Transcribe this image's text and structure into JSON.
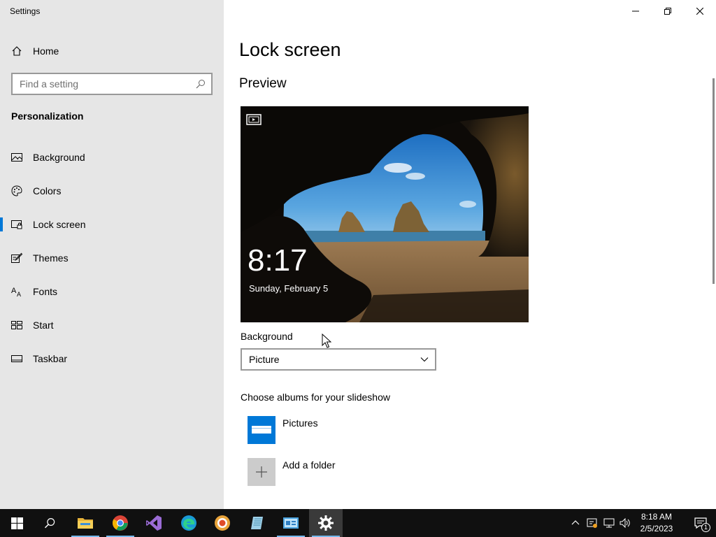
{
  "window": {
    "title": "Settings",
    "controls": [
      "minimize-icon",
      "restore-icon",
      "close-icon"
    ]
  },
  "sidebar": {
    "home_label": "Home",
    "search_placeholder": "Find a setting",
    "section_title": "Personalization",
    "items": [
      {
        "label": "Background",
        "icon": "picture-icon",
        "selected": false
      },
      {
        "label": "Colors",
        "icon": "palette-icon",
        "selected": false
      },
      {
        "label": "Lock screen",
        "icon": "lock-screen-icon",
        "selected": true
      },
      {
        "label": "Themes",
        "icon": "brush-icon",
        "selected": false
      },
      {
        "label": "Fonts",
        "icon": "font-icon",
        "selected": false
      },
      {
        "label": "Start",
        "icon": "start-icon",
        "selected": false
      },
      {
        "label": "Taskbar",
        "icon": "taskbar-icon",
        "selected": false
      }
    ]
  },
  "main": {
    "title": "Lock screen",
    "preview_heading": "Preview",
    "preview": {
      "time": "8:17",
      "date": "Sunday, February 5"
    },
    "background_label": "Background",
    "background_value": "Picture",
    "albums_label": "Choose albums for your slideshow",
    "albums": [
      {
        "label": "Pictures",
        "icon": "folder-pictures-icon"
      },
      {
        "label": "Add a folder",
        "icon": "plus-icon"
      }
    ]
  },
  "taskbar": {
    "apps": [
      "start-icon",
      "search-icon",
      "file-explorer-icon",
      "chrome-icon",
      "visual-studio-icon",
      "edge-icon",
      "brave-icon",
      "notepad-icon",
      "control-panel-icon",
      "settings-icon"
    ],
    "tray_icons": [
      "chevron-up-icon",
      "security-icon",
      "network-icon",
      "volume-icon"
    ],
    "clock_time": "8:18 AM",
    "clock_date": "2/5/2023",
    "notification_count": "1"
  },
  "colors": {
    "accent": "#0078d7",
    "sidebar_bg": "#e6e6e6",
    "taskbar_bg": "#101010"
  }
}
